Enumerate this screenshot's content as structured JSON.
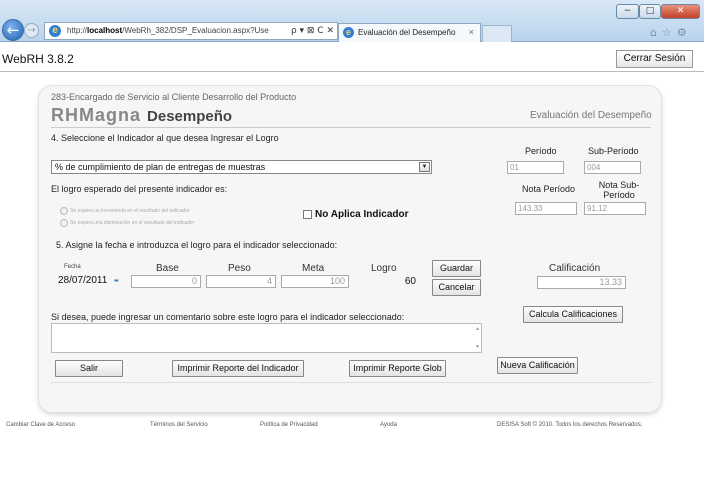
{
  "browser": {
    "url_prefix": "http://",
    "url_host": "localhost",
    "url_path": "/WebRh_382/DSP_Evaluacion.aspx?Use",
    "url_controls": "ρ ▾ ⊠ C ✕",
    "tab_title": "Evaluación del Desempeño",
    "tab_close": "×",
    "back_glyph": "←",
    "forward_glyph": "→",
    "ie_glyph": "e",
    "window_min": "−",
    "window_max": "□",
    "window_close": "✕",
    "tools_glyphs": "⌂☆⚙"
  },
  "header": {
    "app_title": "WebRH 3.8.2",
    "logout_label": "Cerrar Sesión"
  },
  "panel": {
    "subtitle": "283-Encargado de Servicio al Cliente Desarrollo del Producto",
    "brand": "RHMagna",
    "brand_module": "Desempeño",
    "module_title": "Evaluación del Desempeño"
  },
  "indicator": {
    "question": "4. Seleccione el Indicador al que desea Ingresar el Logro",
    "selected": "% de cumplimiento de plan de entregas de muestras",
    "arrow": "▼"
  },
  "period": {
    "periodo_label": "Período",
    "subperiodo_label": "Sub-Período",
    "periodo_value": "01",
    "subperiodo_value": "004"
  },
  "expected": {
    "question": "El logro esperado del presente indicador es:",
    "option1": "Se espera un incremento en el resultado del indicador",
    "option2": "Se espera una disminución en el resultado del indicador",
    "no_aplica_label": "No Aplica Indicador"
  },
  "notas": {
    "nota_periodo_label": "Nota Período",
    "nota_subperiodo_label": "Nota Sub-Período",
    "nota_periodo_value": "143.33",
    "nota_subperiodo_value": "91.12"
  },
  "logro": {
    "question": "5. Asigne la fecha e introduzca el logro para el indicador seleccionado:",
    "fecha_label": "Fecha",
    "fecha_value": "28/07/2011",
    "calendar_glyph": "▪▪",
    "base_label": "Base",
    "peso_label": "Peso",
    "meta_label": "Meta",
    "logro_label": "Logro",
    "base_value": "0",
    "peso_value": "4",
    "meta_value": "100",
    "logro_value": "60",
    "guardar_label": "Guardar",
    "cancelar_label": "Cancelar",
    "calificacion_label": "Calificación",
    "calificacion_value": "13.33"
  },
  "comment": {
    "question": "Si desea, puede ingresar un comentario sobre este logro para el indicador seleccionado:",
    "value": "",
    "scroll_up": "▲",
    "scroll_down": "▼",
    "calcula_label": "Calcula Calificaciones"
  },
  "actions": {
    "salir": "Salir",
    "imprimir_indicador": "Imprimir Reporte del Indicador",
    "imprimir_global": "Imprimir Reporte Glob",
    "nueva_calificacion": "Nueva Calificación"
  },
  "footer": {
    "cambiar_clave": "Cambiar Clave de Acceso",
    "terminos": "Términos del Servicio",
    "privacidad": "Política de Privacidad",
    "ayuda": "Ayuda",
    "copyright": "DESISA Soft © 2010. Todos los derechos Reservados."
  }
}
